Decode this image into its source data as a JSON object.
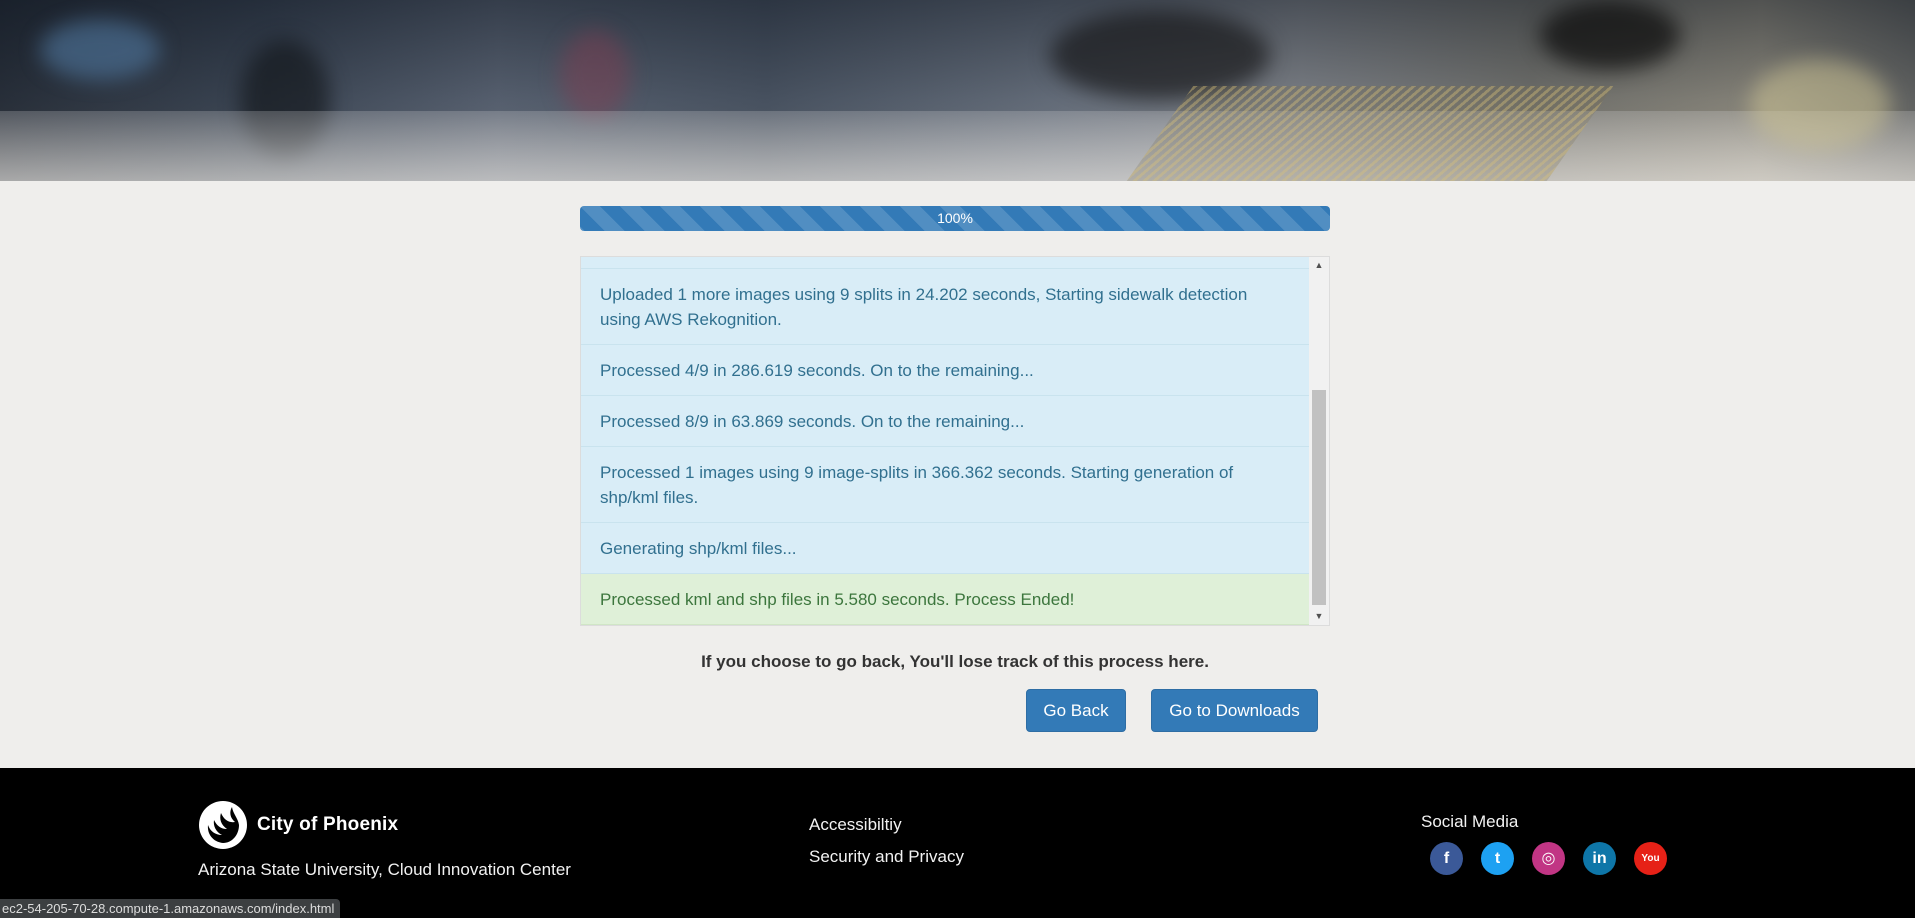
{
  "progress": {
    "label": "100%",
    "value": 1.0
  },
  "log": [
    {
      "text": "",
      "type": "info"
    },
    {
      "text": "Uploaded 1 more images using 9 splits in 24.202 seconds, Starting sidewalk detection using AWS Rekognition.",
      "type": "info"
    },
    {
      "text": "Processed 4/9 in 286.619 seconds. On to the remaining...",
      "type": "info"
    },
    {
      "text": "Processed 8/9 in 63.869 seconds. On to the remaining...",
      "type": "info"
    },
    {
      "text": "Processed 1 images using 9 image-splits in 366.362 seconds. Starting generation of shp/kml files.",
      "type": "info"
    },
    {
      "text": "Generating shp/kml files...",
      "type": "info"
    },
    {
      "text": "Processed kml and shp files in 5.580 seconds. Process Ended!",
      "type": "success"
    }
  ],
  "warning": "If you choose to go back, You'll lose track of this process here.",
  "buttons": {
    "back": "Go Back",
    "downloads": "Go to Downloads"
  },
  "footer": {
    "logo_text": "City of Phoenix",
    "org": "Arizona State University, Cloud Innovation Center",
    "links": [
      "Accessibiltiy",
      "Security and Privacy"
    ],
    "social_title": "Social Media",
    "social": [
      {
        "name": "facebook-icon",
        "glyph": "f",
        "color": "#3b5998"
      },
      {
        "name": "twitter-icon",
        "glyph": "t",
        "color": "#1da1f2"
      },
      {
        "name": "instagram-icon",
        "glyph": "◎",
        "color": "#c13584"
      },
      {
        "name": "linkedin-icon",
        "glyph": "in",
        "color": "#0e76a8"
      },
      {
        "name": "youtube-icon",
        "glyph": "You",
        "color": "#e62117"
      }
    ]
  },
  "status_url": "ec2-54-205-70-28.compute-1.amazonaws.com/index.html"
}
